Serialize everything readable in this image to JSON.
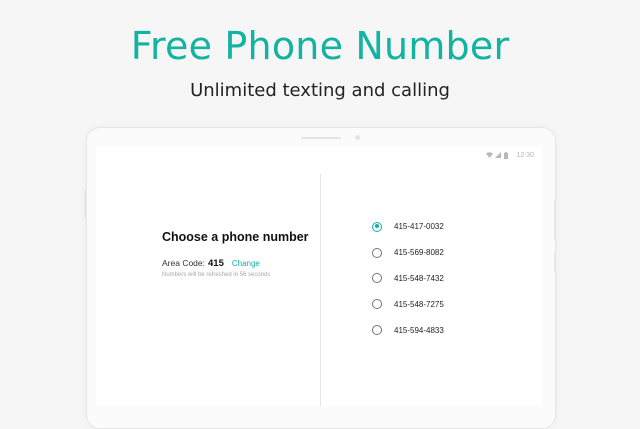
{
  "hero": {
    "title": "Free Phone Number",
    "subtitle": "Unlimited texting and calling"
  },
  "status_bar": {
    "time": "12:30",
    "icons": [
      "wifi-icon",
      "signal-icon",
      "battery-icon"
    ]
  },
  "left_panel": {
    "title": "Choose a phone number",
    "area_code_label": "Area Code:",
    "area_code_value": "415",
    "change_label": "Change",
    "refresh_note": "Numbers will be refreshed in 56 seconds"
  },
  "numbers": [
    {
      "number": "415-417-0032",
      "selected": true
    },
    {
      "number": "415-569-8082",
      "selected": false
    },
    {
      "number": "415-548-7432",
      "selected": false
    },
    {
      "number": "415-548-7275",
      "selected": false
    },
    {
      "number": "415-594-4833",
      "selected": false
    }
  ],
  "colors": {
    "accent": "#12b3a1",
    "background": "#f6f6f6"
  }
}
